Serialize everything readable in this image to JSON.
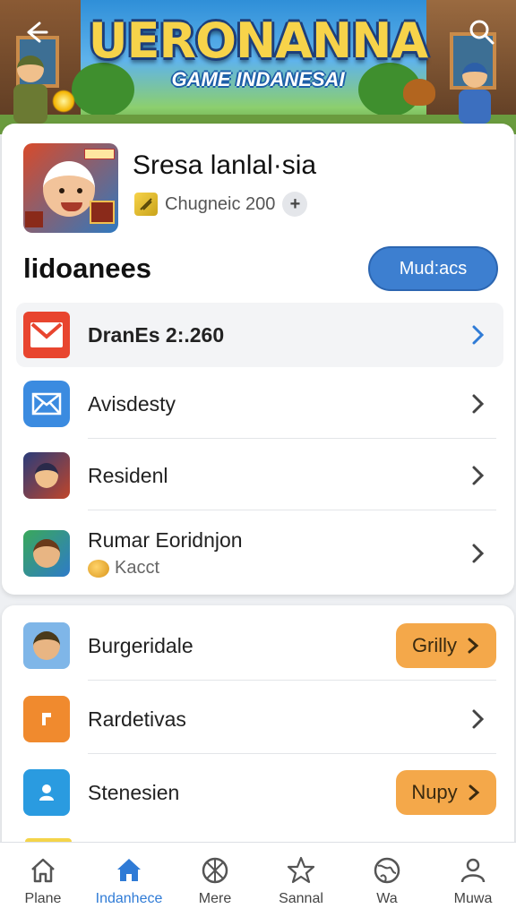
{
  "header": {
    "title": "UERONANNA",
    "subtitle": "GAME INDANESAI"
  },
  "profile": {
    "name": "Sresa lanlal·sia",
    "meta": "Chugneic 200",
    "plus": "+"
  },
  "section": {
    "title": "lidoanees",
    "button": "Mud:acs"
  },
  "list1": [
    {
      "label": "DranEs 2:.260",
      "icon": "mail-icon"
    },
    {
      "label": "Avisdesty",
      "icon": "envelope-icon"
    },
    {
      "label": "Residenl",
      "icon": "character-avatar-icon"
    },
    {
      "label": "Rumar Eoridnjon",
      "sub": "Kacct",
      "icon": "character-avatar-icon"
    }
  ],
  "list2": [
    {
      "label": "Burgeridale",
      "pill": "Grilly"
    },
    {
      "label": "Rardetivas"
    },
    {
      "label": "Stenesien",
      "pill": "Nupy"
    }
  ],
  "nav": [
    {
      "label": "Plane",
      "icon": "home-outline-icon"
    },
    {
      "label": "Indanhece",
      "icon": "home-icon",
      "active": true
    },
    {
      "label": "Mere",
      "icon": "globe-icon"
    },
    {
      "label": "Sannal",
      "icon": "star-icon"
    },
    {
      "label": "Wa",
      "icon": "world-icon"
    },
    {
      "label": "Muwa",
      "icon": "person-icon"
    }
  ],
  "colors": {
    "accent": "#3d7fd0",
    "pill": "#f4a84a",
    "mail_red": "#e8452f"
  }
}
